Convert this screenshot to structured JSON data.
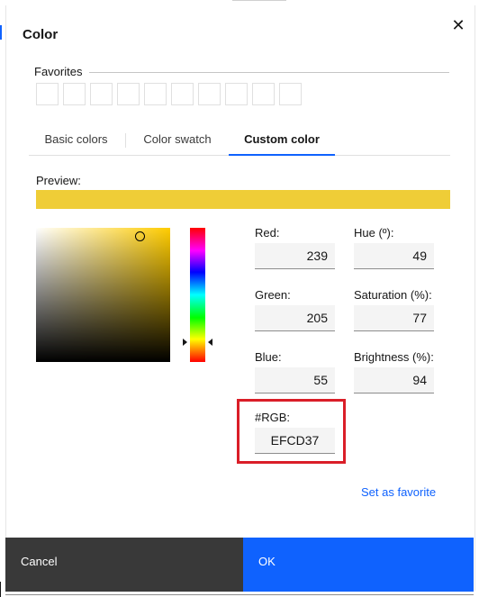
{
  "dialog": {
    "title": "Color",
    "close_icon": "close-icon"
  },
  "favorites": {
    "label": "Favorites",
    "slots": 10
  },
  "tabs": [
    {
      "label": "Basic colors",
      "active": false
    },
    {
      "label": "Color swatch",
      "active": false
    },
    {
      "label": "Custom color",
      "active": true
    }
  ],
  "preview": {
    "label": "Preview:",
    "color": "#EFCD37"
  },
  "picker": {
    "hue_color": "#FFCC00"
  },
  "fields": {
    "red": {
      "label": "Red:",
      "value": "239"
    },
    "green": {
      "label": "Green:",
      "value": "205"
    },
    "blue": {
      "label": "Blue:",
      "value": "55"
    },
    "hue": {
      "label": "Hue (º):",
      "value": "49"
    },
    "saturation": {
      "label": "Saturation (%):",
      "value": "77"
    },
    "brightness": {
      "label": "Brightness (%):",
      "value": "94"
    },
    "rgb": {
      "label": "#RGB:",
      "value": "EFCD37"
    }
  },
  "actions": {
    "set_favorite": "Set as favorite",
    "cancel": "Cancel",
    "ok": "OK"
  },
  "colors": {
    "accent": "#0f62fe",
    "highlight": "#da1e28",
    "cancel_bg": "#393939"
  }
}
